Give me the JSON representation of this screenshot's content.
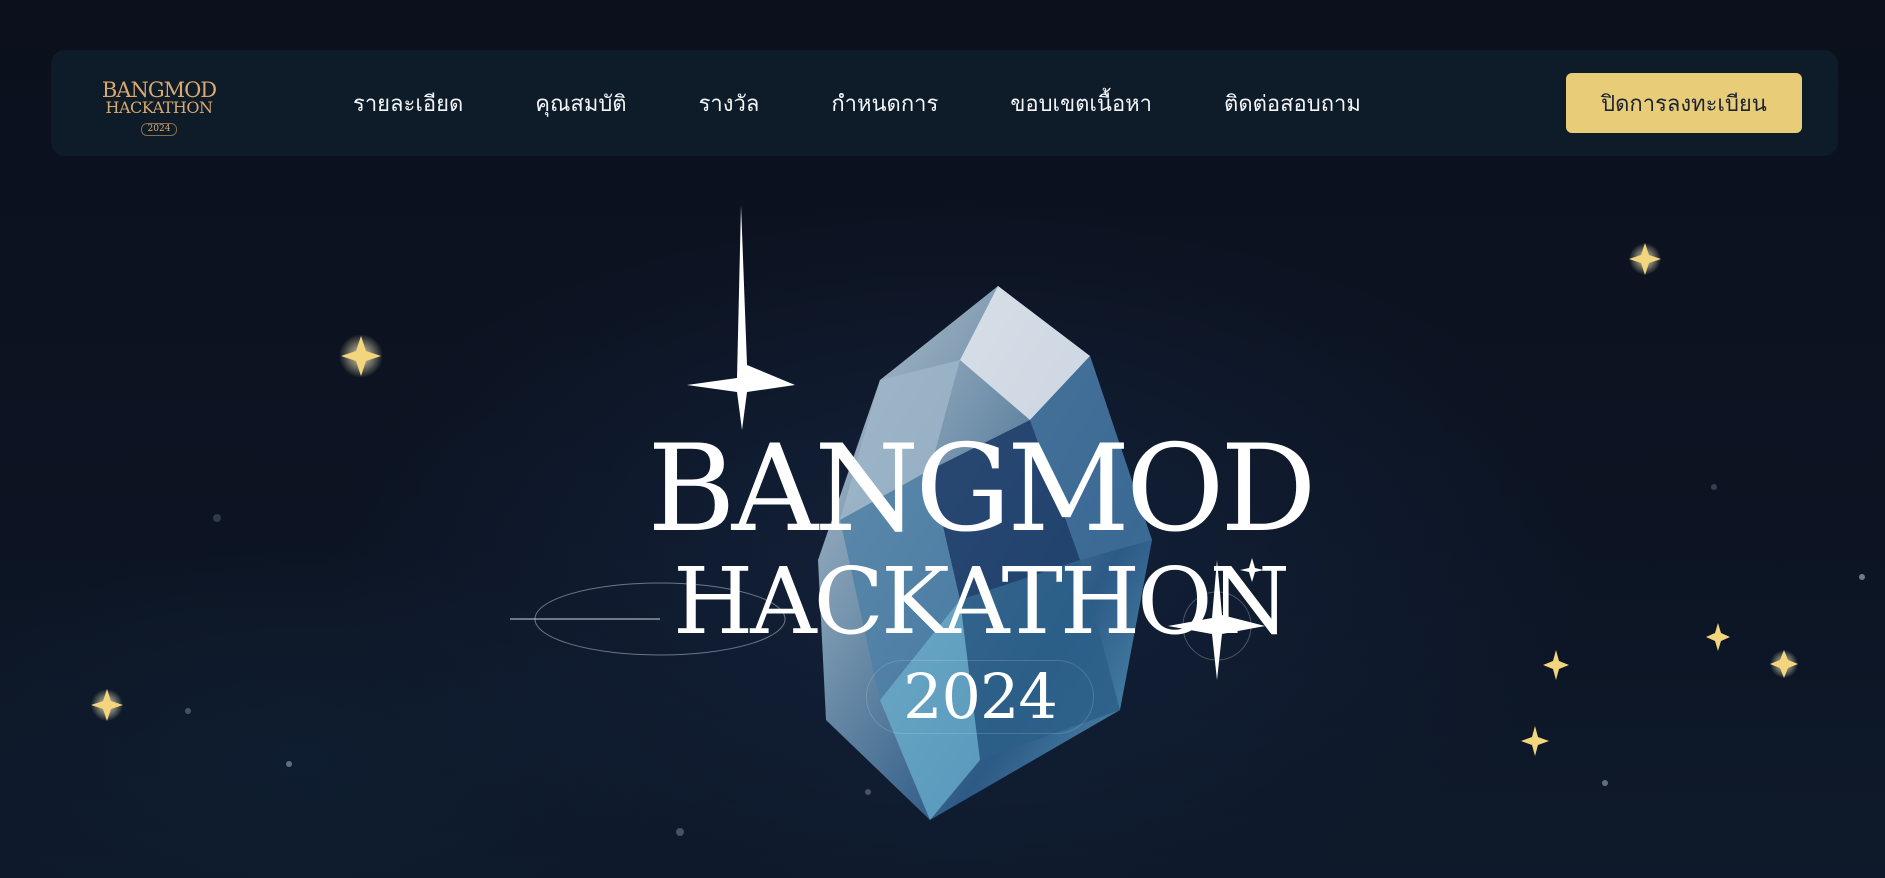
{
  "brand": {
    "logo_line1": "BANGMOD",
    "logo_line2": "HACKATHON",
    "logo_year": "2024"
  },
  "nav": {
    "items": [
      {
        "label": "รายละเอียด"
      },
      {
        "label": "คุณสมบัติ"
      },
      {
        "label": "รางวัล"
      },
      {
        "label": "กำหนดการ"
      },
      {
        "label": "ขอบเขตเนื้อหา"
      },
      {
        "label": "ติดต่อสอบถาม"
      }
    ],
    "register_label": "ปิดการลงทะเบียน"
  },
  "hero": {
    "title_line1": "BANGMOD",
    "title_line2": "HACKATHON",
    "year": "2024"
  },
  "colors": {
    "background": "#0b101c",
    "navbar": "#0e1b28",
    "accent_gold": "#e8cc78",
    "logo_gold": "#d9a970",
    "text_light": "#f2f4f7"
  },
  "icons": {
    "sparkle": "four-point-star-icon",
    "crystal": "crystal-gem-icon"
  }
}
